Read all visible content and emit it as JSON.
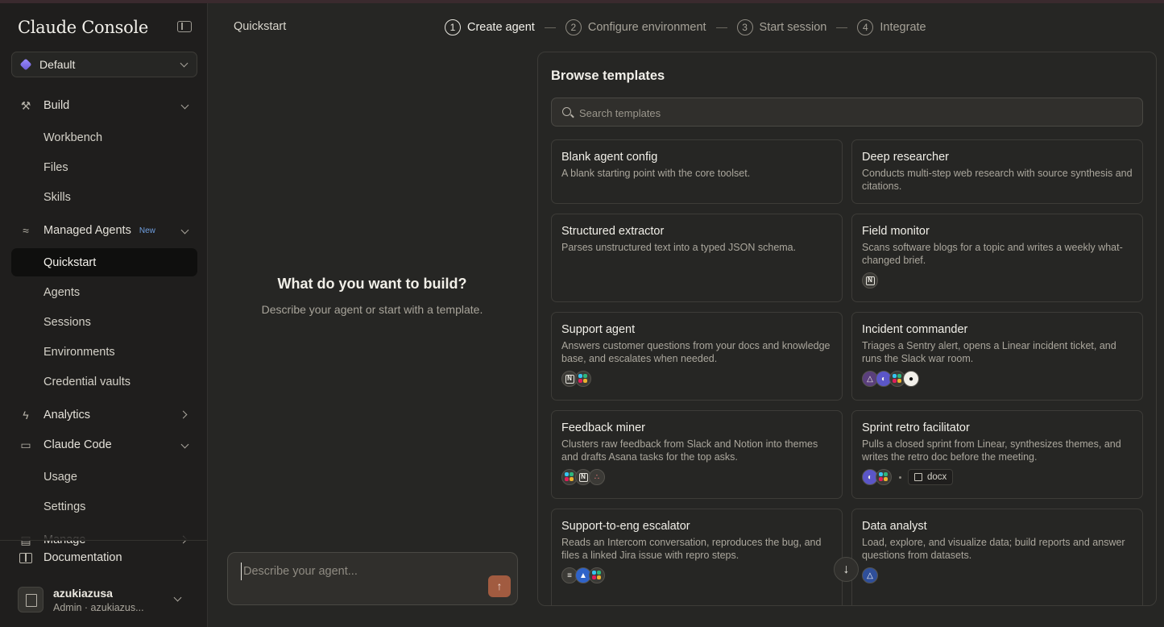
{
  "sidebar": {
    "brand": "Claude Console",
    "workspace": "Default",
    "build": {
      "label": "Build",
      "items": [
        "Workbench",
        "Files",
        "Skills"
      ]
    },
    "managed": {
      "label": "Managed Agents",
      "badge": "New",
      "items": [
        "Quickstart",
        "Agents",
        "Sessions",
        "Environments",
        "Credential vaults"
      ]
    },
    "analytics": {
      "label": "Analytics"
    },
    "claude_code": {
      "label": "Claude Code",
      "items": [
        "Usage",
        "Settings"
      ]
    },
    "manage": {
      "label": "Manage"
    },
    "documentation": "Documentation",
    "user": {
      "name": "azukiazusa",
      "role": "Admin · azukiazus..."
    }
  },
  "main": {
    "page_title": "Quickstart",
    "steps": [
      {
        "num": "1",
        "label": "Create agent"
      },
      {
        "num": "2",
        "label": "Configure environment"
      },
      {
        "num": "3",
        "label": "Start session"
      },
      {
        "num": "4",
        "label": "Integrate"
      }
    ],
    "prompt_title": "What do you want to build?",
    "prompt_subtitle": "Describe your agent or start with a template.",
    "composer_placeholder": "Describe your agent..."
  },
  "templates": {
    "title": "Browse templates",
    "search_placeholder": "Search templates",
    "cards": [
      {
        "title": "Blank agent config",
        "desc": "A blank starting point with the core toolset."
      },
      {
        "title": "Deep researcher",
        "desc": "Conducts multi-step web research with source synthesis and citations."
      },
      {
        "title": "Structured extractor",
        "desc": "Parses unstructured text into a typed JSON schema."
      },
      {
        "title": "Field monitor",
        "desc": "Scans software blogs for a topic and writes a weekly what-changed brief.",
        "icons": [
          "notion-icon"
        ]
      },
      {
        "title": "Support agent",
        "desc": "Answers customer questions from your docs and knowledge base, and escalates when needed.",
        "icons": [
          "notion-icon",
          "slack-icon"
        ]
      },
      {
        "title": "Incident commander",
        "desc": "Triages a Sentry alert, opens a Linear incident ticket, and runs the Slack war room.",
        "icons": [
          "sentry-icon",
          "linear-icon",
          "slack-icon",
          "github-icon"
        ]
      },
      {
        "title": "Feedback miner",
        "desc": "Clusters raw feedback from Slack and Notion into themes and drafts Asana tasks for the top asks.",
        "icons": [
          "slack-icon",
          "notion-icon",
          "asana-icon"
        ]
      },
      {
        "title": "Sprint retro facilitator",
        "desc": "Pulls a closed sprint from Linear, synthesizes themes, and writes the retro doc before the meeting.",
        "icons": [
          "linear-icon",
          "slack-icon"
        ],
        "file_chip": "docx"
      },
      {
        "title": "Support-to-eng escalator",
        "desc": "Reads an Intercom conversation, reproduces the bug, and files a linked Jira issue with repro steps.",
        "icons": [
          "intercom-icon",
          "jira-icon",
          "slack-icon"
        ]
      },
      {
        "title": "Data analyst",
        "desc": "Load, explore, and visualize data; build reports and answer questions from datasets.",
        "icons": [
          "drive-icon"
        ]
      }
    ]
  }
}
